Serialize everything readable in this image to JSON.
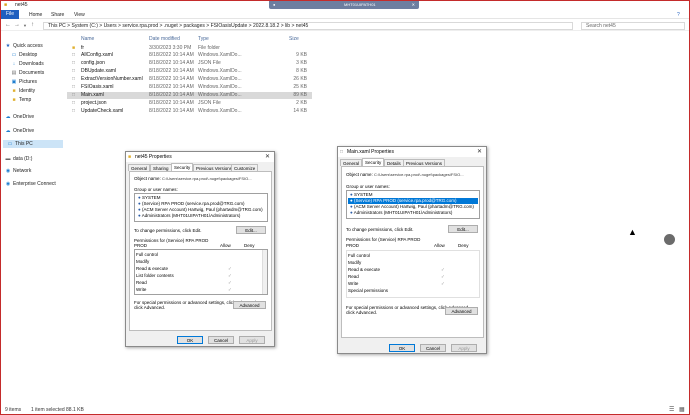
{
  "window": {
    "title": "net45",
    "remote_host": "MHT01UIPATH01"
  },
  "ribbon": {
    "tabs": [
      "File",
      "Home",
      "Share",
      "View"
    ]
  },
  "address": {
    "path": "This PC  >  System (C:)  >  Users  >  service.rpa.prod  >  .nuget  >  packages  >  FSIOasisUpdate  >  2022.8.18.2  >  lib  >  net45",
    "search_placeholder": "Search net45"
  },
  "nav": {
    "items": [
      {
        "icon": "★",
        "label": "Quick access"
      },
      {
        "icon": "▭",
        "label": "Desktop"
      },
      {
        "icon": "↓",
        "label": "Downloads"
      },
      {
        "icon": "▤",
        "label": "Documents"
      },
      {
        "icon": "▣",
        "label": "Pictures"
      },
      {
        "icon": "■",
        "label": "Identity"
      },
      {
        "icon": "■",
        "label": "Temp"
      },
      {
        "icon": "☁",
        "label": "OneDrive"
      },
      {
        "icon": "☁",
        "label": "OneDrive"
      },
      {
        "icon": "▭",
        "label": "This PC"
      },
      {
        "icon": "▬",
        "label": "data (D:)"
      },
      {
        "icon": "◉",
        "label": "Network"
      },
      {
        "icon": "◉",
        "label": "Enterprise Connect"
      }
    ]
  },
  "filelist": {
    "headers": {
      "name": "Name",
      "date": "Date modified",
      "type": "Type",
      "size": "Size"
    },
    "rows": [
      {
        "icon": "■",
        "name": "fr",
        "date": "3/30/2023 3:30 PM",
        "type": "File folder",
        "size": ""
      },
      {
        "icon": "□",
        "name": "AllConfig.xaml",
        "date": "8/18/2022 10:14 AM",
        "type": "Windows.XamlDo...",
        "size": "9 KB"
      },
      {
        "icon": "□",
        "name": "config.json",
        "date": "8/18/2022 10:14 AM",
        "type": "JSON File",
        "size": "3 KB"
      },
      {
        "icon": "□",
        "name": "DBUpdate.xaml",
        "date": "8/18/2022 10:14 AM",
        "type": "Windows.XamlDo...",
        "size": "8 KB"
      },
      {
        "icon": "□",
        "name": "ExtractVersionNumber.xaml",
        "date": "8/18/2022 10:14 AM",
        "type": "Windows.XamlDo...",
        "size": "26 KB"
      },
      {
        "icon": "□",
        "name": "FSIOasis.xaml",
        "date": "8/18/2022 10:14 AM",
        "type": "Windows.XamlDo...",
        "size": "25 KB"
      },
      {
        "icon": "□",
        "name": "Main.xaml",
        "date": "8/18/2022 10:14 AM",
        "type": "Windows.XamlDo...",
        "size": "89 KB"
      },
      {
        "icon": "□",
        "name": "project.json",
        "date": "8/18/2022 10:14 AM",
        "type": "JSON File",
        "size": "2 KB"
      },
      {
        "icon": "□",
        "name": "UpdateCheck.xaml",
        "date": "8/18/2022 10:14 AM",
        "type": "Windows.XamlDo...",
        "size": "14 KB"
      }
    ]
  },
  "status": {
    "count": "9 items",
    "selection": "1 item selected  88.1 KB"
  },
  "dialog1": {
    "title": "net45 Properties",
    "tabs": [
      "General",
      "Sharing",
      "Security",
      "Previous Versions",
      "Customize"
    ],
    "object_label": "Object name:",
    "object_value": "C:\\Users\\service.rpa.prod\\.nuget\\packages\\FSIO...",
    "group_label": "Group or user names:",
    "groups": [
      "SYSTEM",
      "(Service) RPA PROD (service.rpa.prod@TRG.com)",
      "(ACM Server Account) Hartwig, Paul (phartwdm@TRG.com)",
      "Administrators (MHT01UIPATH01\\Administrators)"
    ],
    "change_text": "To change permissions, click Edit.",
    "edit": "Edit...",
    "perm_label": "Permissions for (Service) RPA PROD",
    "allow": "Allow",
    "deny": "Deny",
    "perms": [
      "Full control",
      "Modify",
      "Read & execute",
      "List folder contents",
      "Read",
      "Write"
    ],
    "special_text": "For special permissions or advanced settings, click Advanced.",
    "advanced": "Advanced",
    "ok": "OK",
    "cancel": "Cancel",
    "apply": "Apply"
  },
  "dialog2": {
    "title": "Main.xaml Properties",
    "tabs": [
      "General",
      "Security",
      "Details",
      "Previous Versions"
    ],
    "object_label": "Object name:",
    "object_value": "C:\\Users\\service.rpa.prod\\.nuget\\packages\\FSIO...",
    "group_label": "Group or user names:",
    "groups": [
      "SYSTEM",
      "(Service) RPA PROD (service.rpa.prod@TRG.com)",
      "(ACM Server Account) Hartwig, Paul (phartadm@TRG.com)",
      "Administrators (MHT01UIPATH01\\Administrators)"
    ],
    "change_text": "To change permissions, click Edit.",
    "edit": "Edit...",
    "perm_label": "Permissions for (Service) RPA PROD",
    "allow": "Allow",
    "deny": "Deny",
    "perms": [
      "Full control",
      "Modify",
      "Read & execute",
      "Read",
      "Write",
      "Special permissions"
    ],
    "special_text": "For special permissions or advanced settings, click Advanced.",
    "advanced": "Advanced",
    "ok": "OK",
    "cancel": "Cancel",
    "apply": "Apply"
  }
}
